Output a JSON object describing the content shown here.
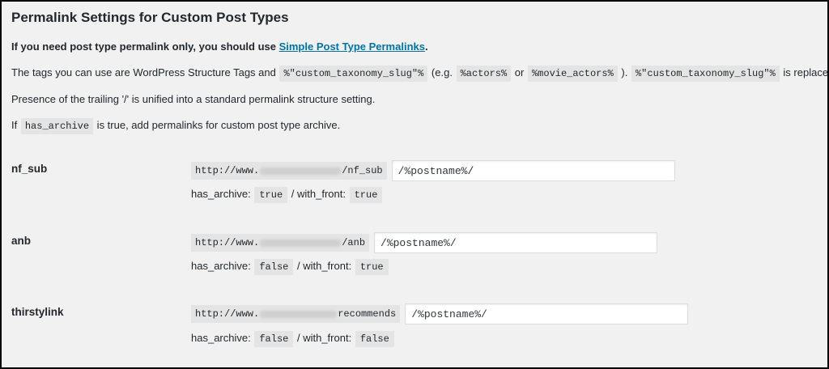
{
  "heading": "Permalink Settings for Custom Post Types",
  "line1": {
    "text": "If you need post type permalink only, you should use ",
    "link": "Simple Post Type Permalinks",
    "end": "."
  },
  "line2": {
    "t1": "The tags you can use are WordPress Structure Tags and ",
    "c1": "%\"custom_taxonomy_slug\"%",
    "t2": " (e.g. ",
    "c2": "%actors%",
    "t3": " or ",
    "c3": "%movie_actors%",
    "t4": " ). ",
    "c4": "%\"custom_taxonomy_slug\"%",
    "t5": " is replaced by"
  },
  "line3": "Presence of the trailing '/' is unified into a standard permalink structure setting.",
  "line4": {
    "t1": "If ",
    "c1": "has_archive",
    "t2": " is true, add permalinks for custom post type archive."
  },
  "post_types": [
    {
      "label": "nf_sub",
      "url_prefix": "http://www.",
      "url_suffix": "/nf_sub",
      "value": "/%postname%/",
      "has_archive_label": "has_archive:",
      "has_archive": "true",
      "with_front_label": "/ with_front:",
      "with_front": "true"
    },
    {
      "label": "anb",
      "url_prefix": "http://www.",
      "url_suffix": "/anb",
      "value": "/%postname%/",
      "has_archive_label": "has_archive:",
      "has_archive": "false",
      "with_front_label": "/ with_front:",
      "with_front": "true"
    },
    {
      "label": "thirstylink",
      "url_prefix": "http://www.",
      "url_suffix": "recommends",
      "value": "/%postname%/",
      "has_archive_label": "has_archive:",
      "has_archive": "false",
      "with_front_label": "/ with_front:",
      "with_front": "false"
    }
  ]
}
